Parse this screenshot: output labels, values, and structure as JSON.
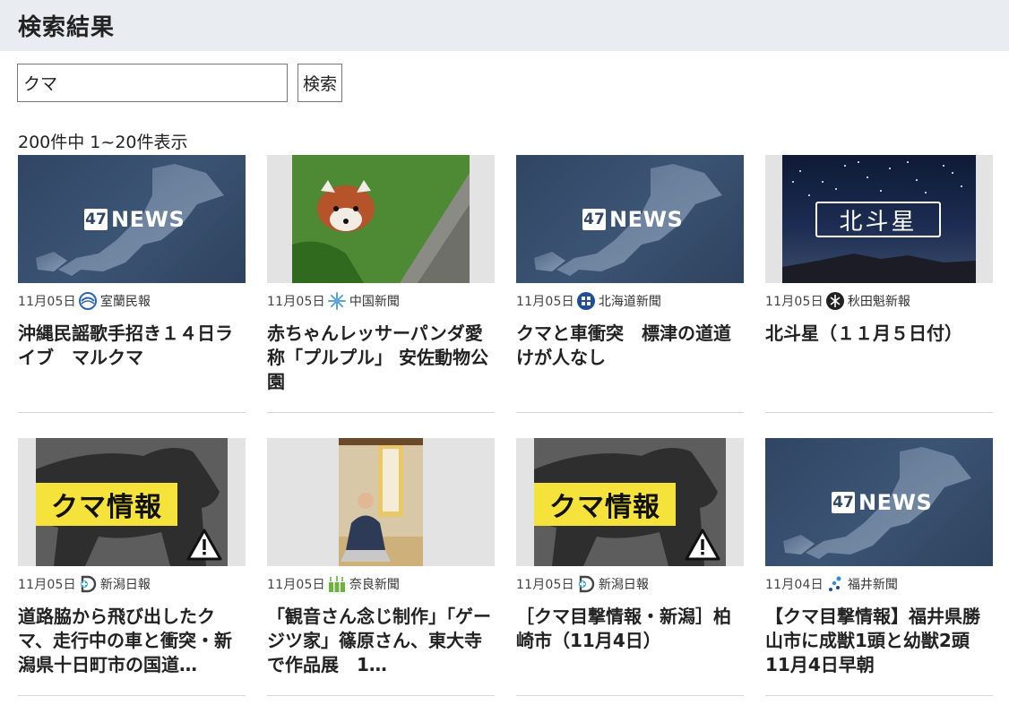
{
  "page": {
    "title": "検索結果"
  },
  "search": {
    "value": "クマ",
    "button_label": "検索"
  },
  "results": {
    "count_text": "200件中 1~20件表示"
  },
  "cards": [
    {
      "date": "11月05日",
      "paper": "室蘭民報",
      "title": "沖縄民謡歌手招き１４日ライブ　マルクマ",
      "thumb": "47news",
      "thumb_text": "NEWS",
      "thumb_num": "47"
    },
    {
      "date": "11月05日",
      "paper": "中国新聞",
      "title": "赤ちゃんレッサーパンダ愛称「プルプル」 安佐動物公園",
      "thumb": "panda"
    },
    {
      "date": "11月05日",
      "paper": "北海道新聞",
      "title": "クマと車衝突　標津の道道　けが人なし",
      "thumb": "47news",
      "thumb_text": "NEWS",
      "thumb_num": "47"
    },
    {
      "date": "11月05日",
      "paper": "秋田魁新報",
      "title": "北斗星（１１月５日付）",
      "thumb": "night",
      "thumb_text": "北斗星"
    },
    {
      "date": "11月05日",
      "paper": "新潟日報",
      "title": "道路脇から飛び出したクマ、走行中の車と衝突・新潟県十日町市の国道…",
      "thumb": "bear",
      "thumb_text": "クマ情報"
    },
    {
      "date": "11月05日",
      "paper": "奈良新聞",
      "title": "「観音さん念じ制作」「ゲージツ家」篠原さん、東大寺で作品展　1…",
      "thumb": "person"
    },
    {
      "date": "11月05日",
      "paper": "新潟日報",
      "title": "［クマ目撃情報・新潟］柏崎市（11月4日）",
      "thumb": "bear",
      "thumb_text": "クマ情報"
    },
    {
      "date": "11月04日",
      "paper": "福井新聞",
      "title": "【クマ目撃情報】福井県勝山市に成獣1頭と幼獣2頭　11月4日早朝",
      "thumb": "47news",
      "thumb_text": "NEWS",
      "thumb_num": "47"
    }
  ]
}
